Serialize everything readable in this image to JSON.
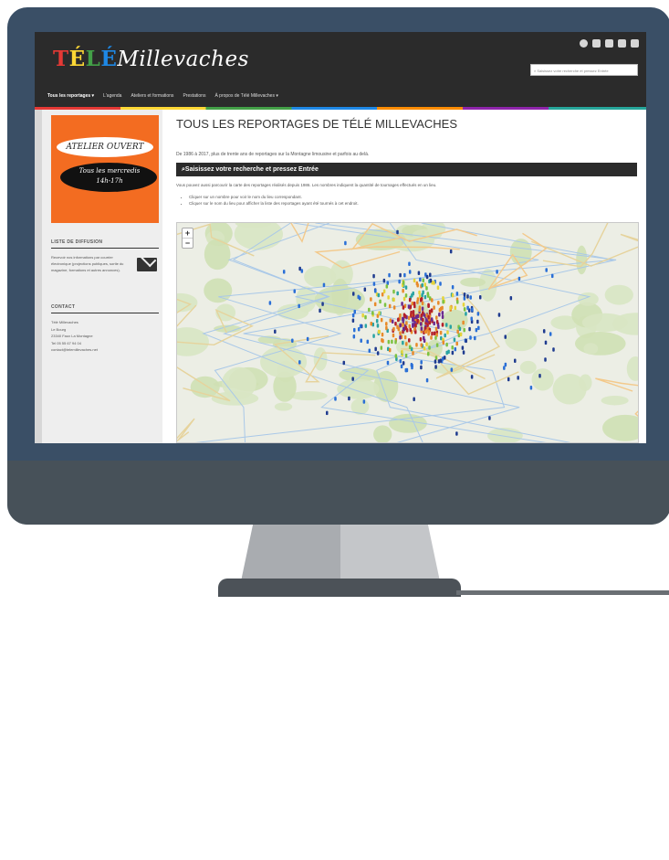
{
  "site": {
    "logo_parts": [
      "T",
      "É",
      "L",
      "É"
    ],
    "logo_rest": "Millevaches",
    "search_placeholder": "Saisissez votre recherche et pressez Entrée",
    "nav": [
      "Tous les reportages ▾",
      "L'agenda",
      "Ateliers et formations",
      "Prestations",
      "À propos de Télé Millevaches ▾"
    ],
    "social_icons": [
      "podcast-icon",
      "facebook-icon",
      "vimeo-icon",
      "rss-icon",
      "mail-icon"
    ]
  },
  "sidebar": {
    "ad_line1": "ATELIER OUVERT",
    "ad_line2": "Tous les mercredis",
    "ad_line3": "14h-17h",
    "mailing_heading": "LISTE DE DIFFUSION",
    "mailing_text": "Recevoir nos informations par courrier électronique (projections publiques, sortie du magazine, formations et autres annonces).",
    "contact_heading": "CONTACT",
    "contact_lines": [
      "Télé Millevaches",
      "Le Bourg",
      "23340 Faux La Montagne",
      "Tel 05 55 67 94 04",
      "contact@telemillevaches.net"
    ]
  },
  "main": {
    "title": "TOUS LES REPORTAGES DE TÉLÉ MILLEVACHES",
    "intro": "De 1986 à 2017, plus de trente ans de reportages sur la Montagne limousine et parfois au delà.",
    "search_label": "Saisissez votre recherche et pressez Entrée",
    "description": "Vous pouvez aussi parcourir la carte des reportages réalisés depuis 1986. Les nombres indiquent la quantité de tournages effectués en un lieu.",
    "bullets": [
      "Cliquer sur un nombre pour voir le nom du lieu correspondant.",
      "Cliquer sur le nom du lieu pour afficher la liste des reportages ayant été tournés à cet endroit."
    ],
    "zoom_in": "+",
    "zoom_out": "−"
  },
  "colors": {
    "header": "#2b2b2b",
    "ad": "#f36c21",
    "monitor": "#3a4f66"
  }
}
